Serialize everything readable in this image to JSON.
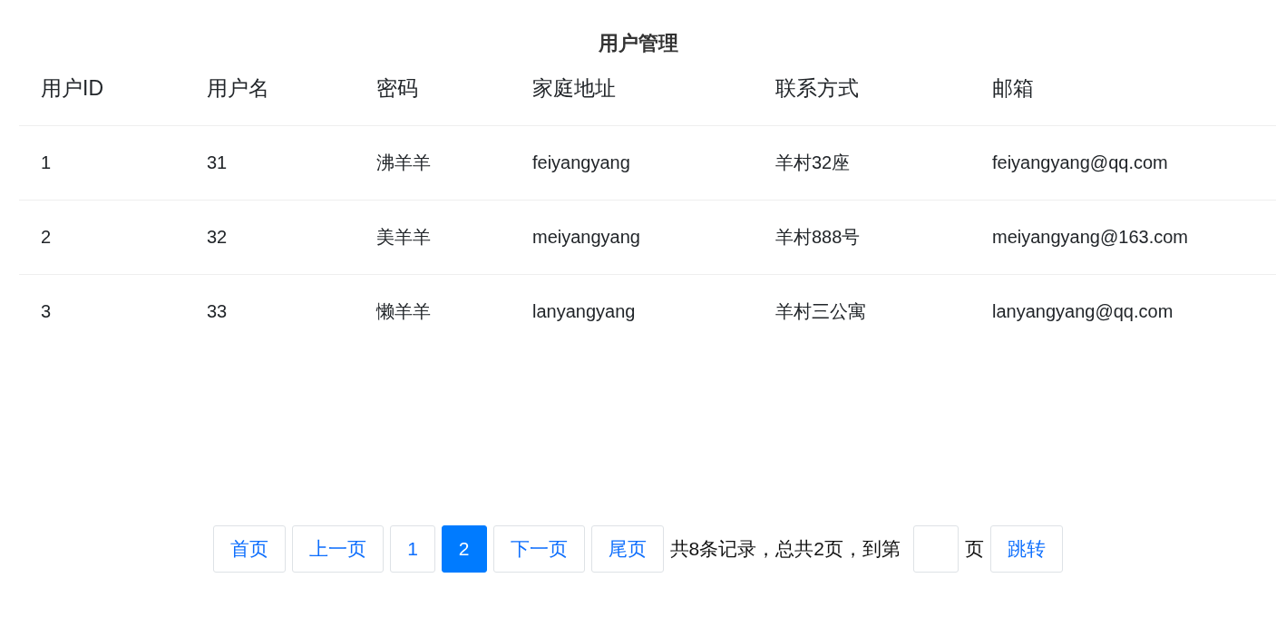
{
  "title": "用户管理",
  "table": {
    "columns": [
      "用户ID",
      "用户名",
      "密码",
      "家庭地址",
      "联系方式",
      "邮箱"
    ],
    "rows": [
      [
        "1",
        "31",
        "沸羊羊",
        "feiyangyang",
        "羊村32座",
        "feiyangyang@qq.com"
      ],
      [
        "2",
        "32",
        "美羊羊",
        "meiyangyang",
        "羊村888号",
        "meiyangyang@163.com"
      ],
      [
        "3",
        "33",
        "懒羊羊",
        "lanyangyang",
        "羊村三公寓",
        "lanyangyang@qq.com"
      ]
    ]
  },
  "pager": {
    "buttons": [
      {
        "label": "首页",
        "selected": false
      },
      {
        "label": "上一页",
        "selected": false
      },
      {
        "label": "1",
        "selected": false
      },
      {
        "label": "2",
        "selected": true
      },
      {
        "label": "下一页",
        "selected": false
      },
      {
        "label": "尾页",
        "selected": false
      }
    ],
    "summary": "共8条记录，总共2页，到第",
    "unit": "页",
    "jump_button": "跳转"
  }
}
